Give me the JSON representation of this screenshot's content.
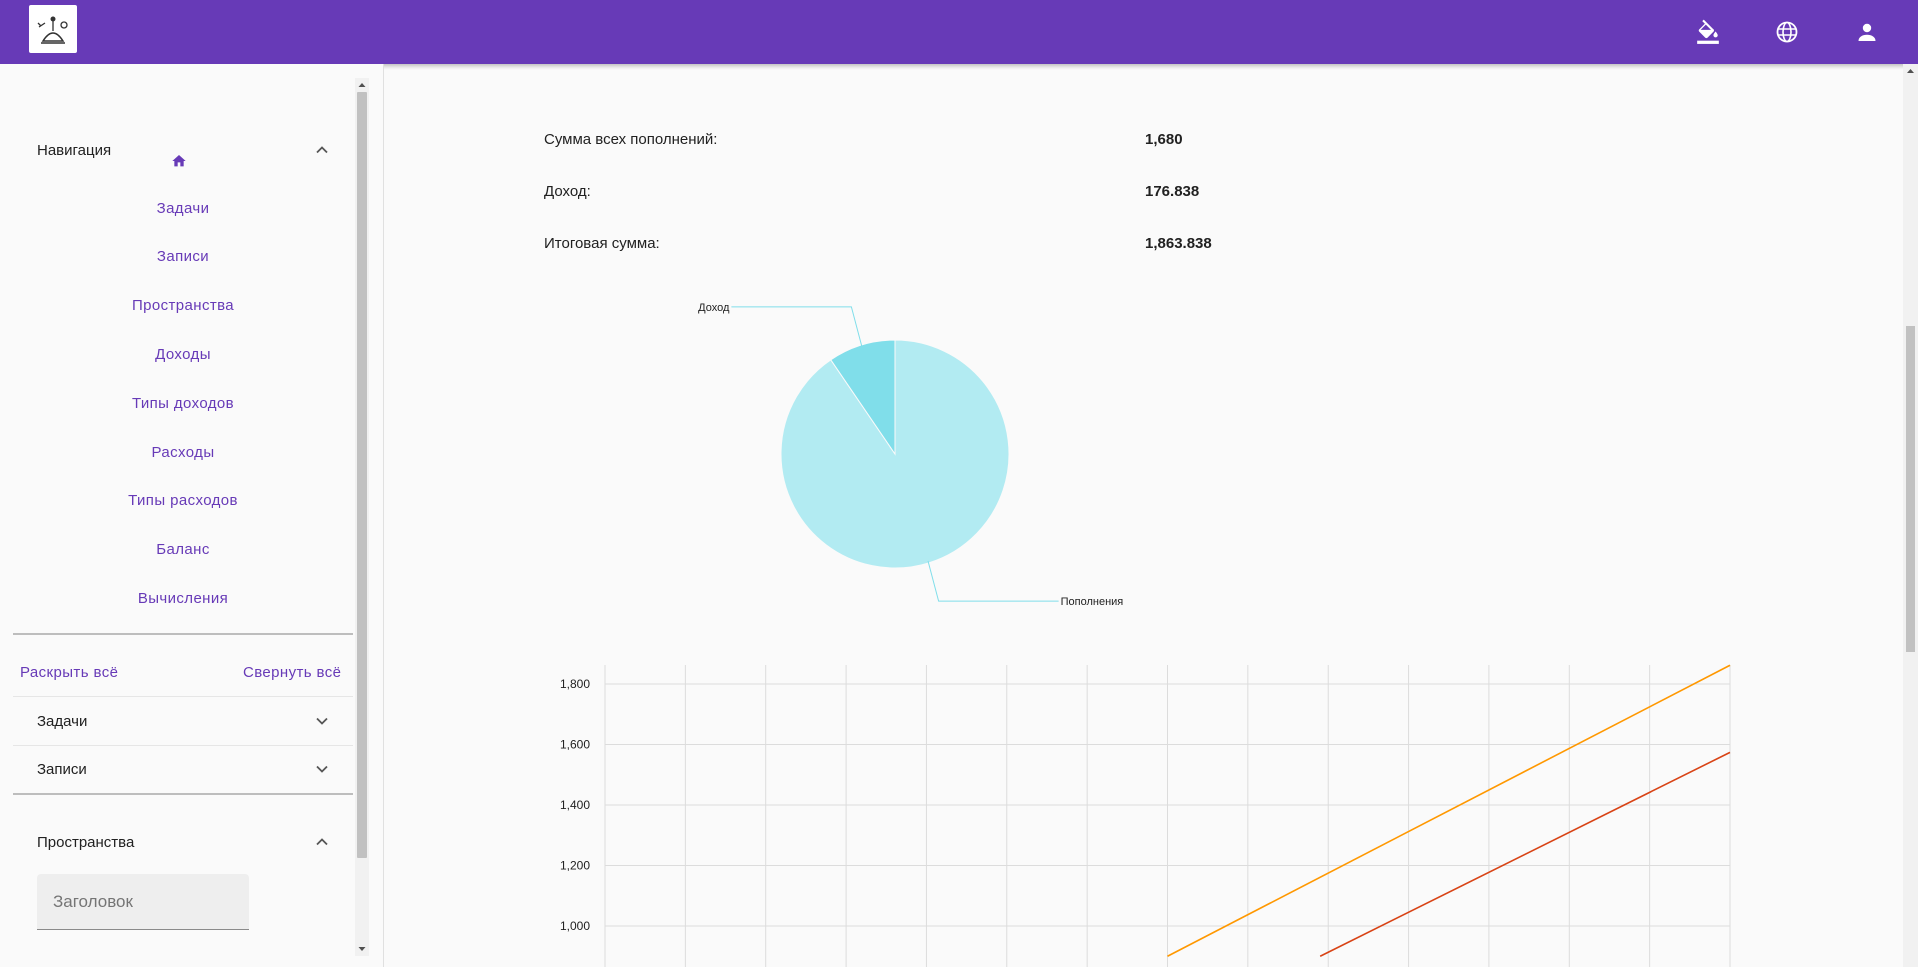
{
  "toolbar": {
    "logo_icon": "app-logo-icon",
    "actions": [
      {
        "icon": "format-paint-icon"
      },
      {
        "icon": "language-globe-icon"
      },
      {
        "icon": "account-person-icon"
      }
    ],
    "color": "#673ab7"
  },
  "sidebar": {
    "navigation": {
      "title": "Навигация",
      "home_icon": "home-icon",
      "links": [
        "Задачи",
        "Записи",
        "Пространства",
        "Доходы",
        "Типы доходов",
        "Расходы",
        "Типы расходов",
        "Баланс",
        "Вычисления"
      ]
    },
    "expand_all": "Раскрыть всё",
    "collapse_all": "Свернуть всё",
    "sections": [
      "Задачи",
      "Записи"
    ],
    "spaces": {
      "title": "Пространства",
      "title_field_placeholder": "Заголовок"
    }
  },
  "summary": {
    "items": [
      {
        "label": "Сумма всех пополнений:",
        "value": "1,680"
      },
      {
        "label": "Доход:",
        "value": "176.838"
      },
      {
        "label": "Итоговая сумма:",
        "value": "1,863.838"
      }
    ]
  },
  "chart_data": [
    {
      "type": "pie",
      "slices": [
        {
          "label": "Пополнения",
          "value": 1680,
          "color": "#b2ebf2"
        },
        {
          "label": "Доход",
          "value": 176.838,
          "color": "#80deea"
        }
      ]
    },
    {
      "type": "line",
      "y_ticks": [
        "1,800",
        "1,600",
        "1,400",
        "1,200",
        "1,000"
      ],
      "ylim": [
        900,
        1900
      ],
      "grid": true,
      "x_grid_count": 15,
      "series": [
        {
          "color": "#ff9800",
          "points": [
            [
              7.0,
              900
            ],
            [
              14,
              1862
            ]
          ]
        },
        {
          "color": "#d84315",
          "points": [
            [
              8.9,
              900
            ],
            [
              14,
              1574
            ]
          ]
        }
      ]
    }
  ]
}
